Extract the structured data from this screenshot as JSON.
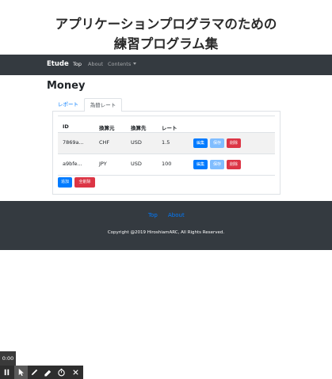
{
  "banner": {
    "line1": "アプリケーションプログラマのための",
    "line2": "練習プログラム集"
  },
  "navbar": {
    "brand": "Etude",
    "links": [
      {
        "label": "Top"
      },
      {
        "label": "About"
      },
      {
        "label": "Contents"
      }
    ]
  },
  "main": {
    "heading": "Money",
    "tabs": [
      {
        "label": "レポート",
        "active": false
      },
      {
        "label": "為替レート",
        "active": true
      }
    ],
    "table": {
      "headers": [
        "ID",
        "換算元",
        "換算先",
        "レート"
      ],
      "rows": [
        {
          "id": "7869a...",
          "from": "CHF",
          "to": "USD",
          "rate": "1.5"
        },
        {
          "id": "a9bfe...",
          "from": "JPY",
          "to": "USD",
          "rate": "100"
        }
      ],
      "row_buttons": {
        "edit": "編集",
        "save": "保存",
        "delete": "削除"
      }
    },
    "actions": {
      "add": "追加",
      "delete_all": "全削除"
    }
  },
  "footer": {
    "links": [
      {
        "label": "Top"
      },
      {
        "label": "About"
      }
    ],
    "copyright": "Copyright @2019 HiroshiamARC, All Rights Reserved."
  },
  "recorder": {
    "time": "0:00",
    "tools": [
      "pause-icon",
      "pointer-icon",
      "pen-icon",
      "highlighter-icon",
      "timer-icon",
      "close-icon"
    ]
  },
  "colors": {
    "navbar": "#343a40",
    "primary": "#007bff",
    "danger": "#dc3545",
    "save_light": "#80bdff"
  }
}
